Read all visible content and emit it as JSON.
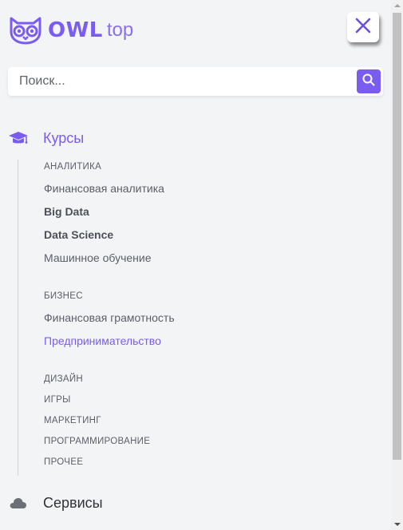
{
  "header": {
    "logo_icon": "owl-icon",
    "logo_brand": "OWL",
    "logo_suffix": "top",
    "close_icon": "close-icon"
  },
  "search": {
    "placeholder": "Поиск...",
    "value": "",
    "button_icon": "search-icon"
  },
  "menu": {
    "courses": {
      "label": "Курсы",
      "icon": "graduation-cap-icon",
      "groups": [
        {
          "category": "АНАЛИТИКА",
          "links": [
            "Финансовая аналитика",
            "Big Data",
            "Data Science",
            "Машинное обучение"
          ]
        },
        {
          "category": "БИЗНЕС",
          "links": [
            "Финансовая грамотность",
            "Предпринимательство"
          ]
        },
        {
          "category": "ДИЗАЙН",
          "links": []
        },
        {
          "category": "ИГРЫ",
          "links": []
        },
        {
          "category": "МАРКЕТИНГ",
          "links": []
        },
        {
          "category": "ПРОГРАММИРОВАНИЕ",
          "links": []
        },
        {
          "category": "ПРОЧЕЕ",
          "links": []
        }
      ]
    },
    "services": {
      "label": "Сервисы",
      "icon": "cloud-icon"
    }
  },
  "colors": {
    "accent": "#7b5cf0",
    "background": "#f3f4f6",
    "text_muted": "#5a5f66"
  }
}
